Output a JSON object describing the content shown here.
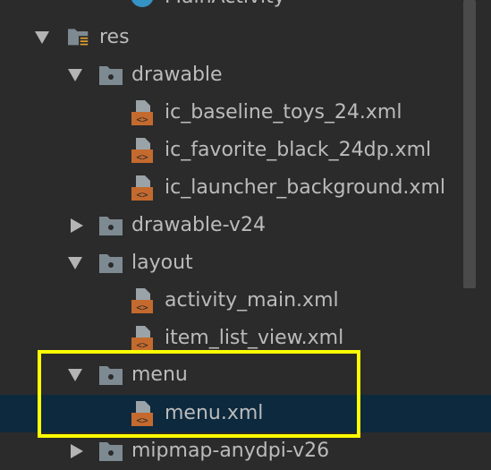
{
  "tree": {
    "top_item": {
      "label": "MainActivity",
      "icon": "kotlin-class-icon"
    },
    "res": {
      "label": "res",
      "expanded": true
    },
    "drawable": {
      "label": "drawable",
      "expanded": true,
      "files": [
        "ic_baseline_toys_24.xml",
        "ic_favorite_black_24dp.xml",
        "ic_launcher_background.xml"
      ]
    },
    "drawable_v24": {
      "label": "drawable-v24",
      "expanded": false
    },
    "layout": {
      "label": "layout",
      "expanded": true,
      "files": [
        "activity_main.xml",
        "item_list_view.xml"
      ]
    },
    "menu": {
      "label": "menu",
      "expanded": true,
      "files": [
        "menu.xml"
      ]
    },
    "mipmap": {
      "label": "mipmap-anydpi-v26",
      "expanded": false
    }
  },
  "colors": {
    "background": "#2b2b2b",
    "selection": "#0d293e",
    "highlight_box": "#ffff00",
    "folder": "#7e8a91",
    "xml_icon": "#c46a2e"
  },
  "selected_item": "menu.xml"
}
